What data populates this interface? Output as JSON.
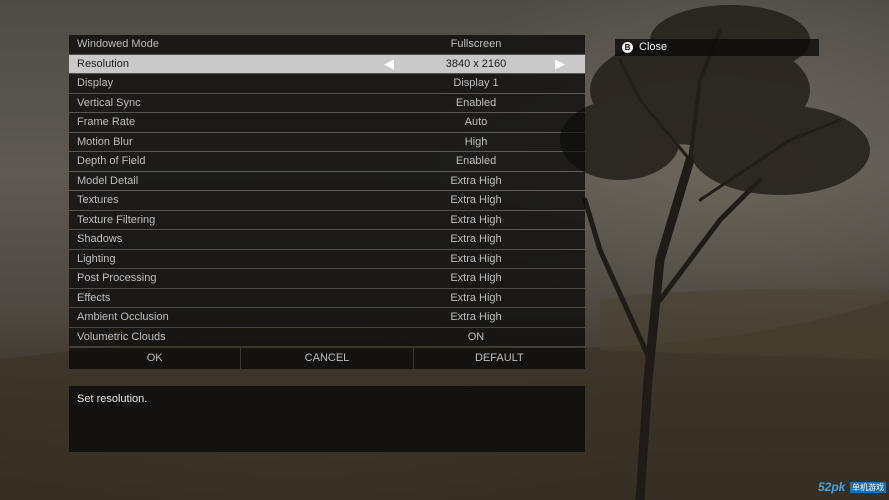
{
  "settings": [
    {
      "label": "Windowed Mode",
      "value": "Fullscreen"
    },
    {
      "label": "Resolution",
      "value": "3840 x 2160",
      "selected": true
    },
    {
      "label": "Display",
      "value": "Display 1"
    },
    {
      "label": "Vertical Sync",
      "value": "Enabled"
    },
    {
      "label": "Frame Rate",
      "value": "Auto"
    },
    {
      "label": "Motion Blur",
      "value": "High"
    },
    {
      "label": "Depth of Field",
      "value": "Enabled"
    },
    {
      "label": "Model Detail",
      "value": "Extra High"
    },
    {
      "label": "Textures",
      "value": "Extra High"
    },
    {
      "label": "Texture Filtering",
      "value": "Extra High"
    },
    {
      "label": "Shadows",
      "value": "Extra High"
    },
    {
      "label": "Lighting",
      "value": "Extra High"
    },
    {
      "label": "Post Processing",
      "value": "Extra High"
    },
    {
      "label": "Effects",
      "value": "Extra High"
    },
    {
      "label": "Ambient Occlusion",
      "value": "Extra High"
    },
    {
      "label": "Volumetric Clouds",
      "value": "ON"
    }
  ],
  "selector_arrows": {
    "left": "◀",
    "right": "▶"
  },
  "actions": {
    "ok": "OK",
    "cancel": "CANCEL",
    "default": "DEFAULT"
  },
  "description": "Set resolution.",
  "close": {
    "button_glyph": "B",
    "label": "Close"
  },
  "watermark": {
    "number": "52pk",
    "text": "单机游戏"
  }
}
